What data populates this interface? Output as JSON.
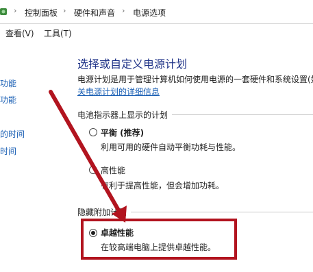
{
  "address_bar": {
    "crumbs": [
      "控制面板",
      "硬件和声音",
      "电源选项"
    ]
  },
  "menu": {
    "view": "查看(V)",
    "tools": "工具(T)"
  },
  "sidebar": {
    "items": [
      "功能",
      "功能",
      "的时间",
      "时间"
    ]
  },
  "main": {
    "title": "选择或自定义电源计划",
    "description": "电源计划是用于管理计算机如何使用电源的一套硬件和系统设置(如",
    "details_link": "关电源计划的详细信息",
    "battery_group_label": "电池指示器上显示的计划",
    "hidden_group_label": "隐藏附加计划",
    "plans": [
      {
        "name": "平衡 (推荐)",
        "desc": "利用可用的硬件自动平衡功耗与性能。",
        "checked": false
      },
      {
        "name": "高性能",
        "desc": "有利于提高性能，但会增加功耗。",
        "checked": false
      },
      {
        "name": "卓越性能",
        "desc": "在较高端电脑上提供卓越性能。",
        "checked": true
      }
    ]
  },
  "colors": {
    "annotation_red": "#b2141f",
    "title_blue": "#1e3287",
    "link_blue": "#1a5fb4"
  }
}
